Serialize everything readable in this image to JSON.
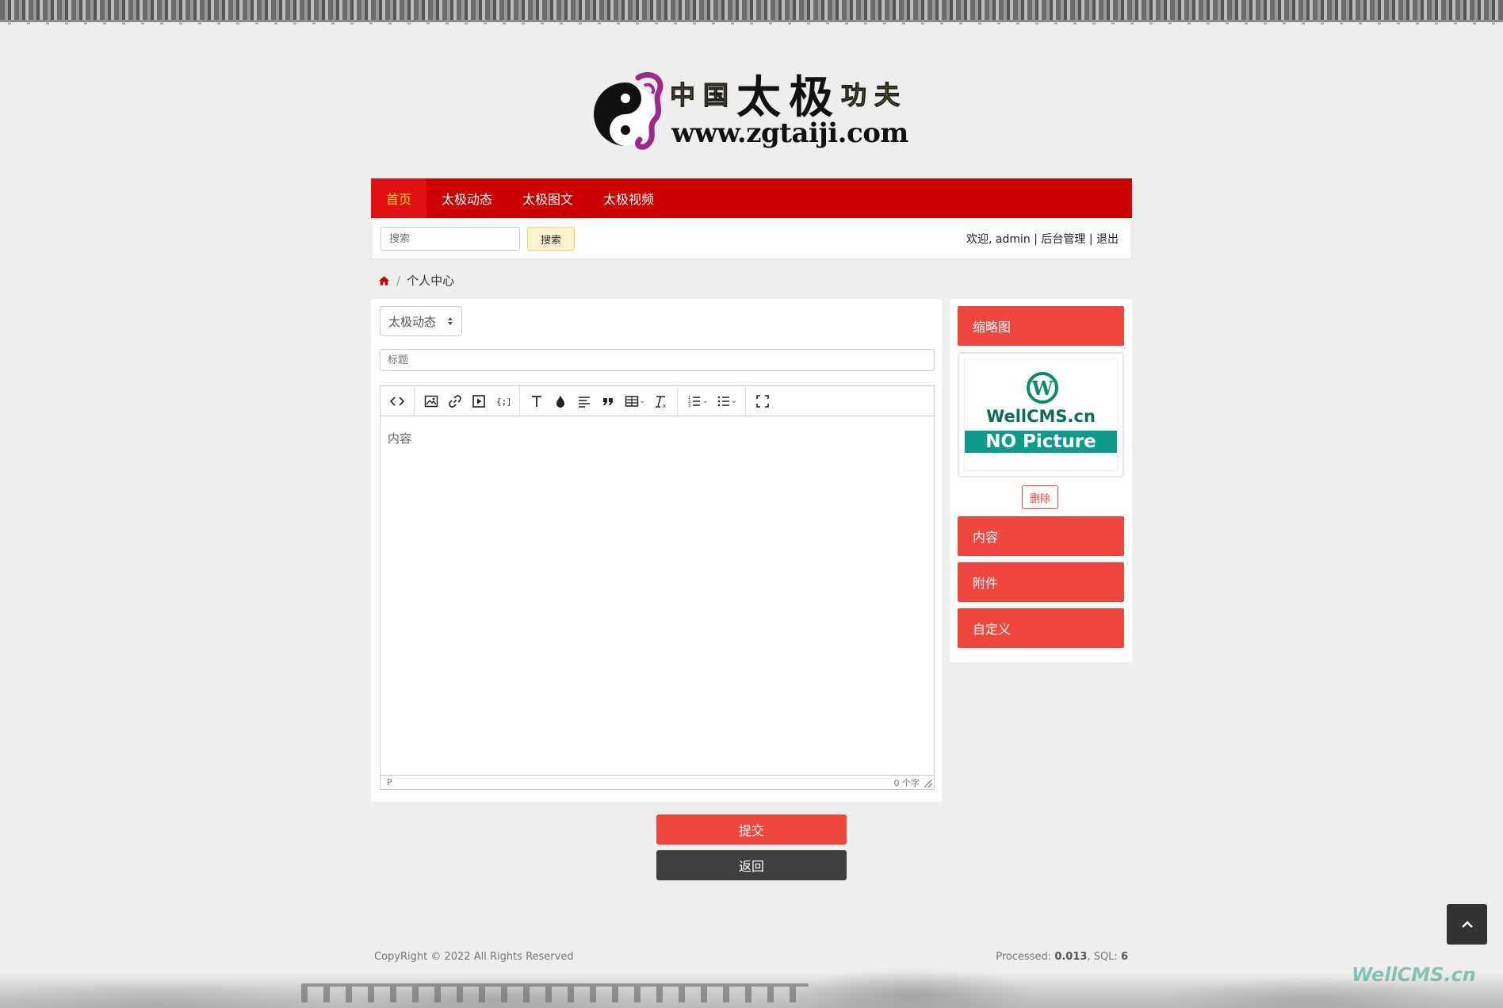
{
  "logo": {
    "chars": [
      "中",
      "国",
      "太",
      "极",
      "功",
      "夫"
    ],
    "url": "www.zgtaiji.com"
  },
  "nav": {
    "items": [
      {
        "label": "首页",
        "active": true
      },
      {
        "label": "太极动态",
        "active": false
      },
      {
        "label": "太极图文",
        "active": false
      },
      {
        "label": "太极视频",
        "active": false
      }
    ]
  },
  "search": {
    "placeholder": "搜索",
    "button_label": "搜索"
  },
  "userbar": {
    "welcome": "欢迎, admin",
    "admin_link": "后台管理",
    "logout_link": "退出",
    "separator": "|"
  },
  "breadcrumb": {
    "home_icon": "home-icon",
    "separator": "/",
    "current": "个人中心"
  },
  "form": {
    "category_selected": "太极动态",
    "title_placeholder": "标题",
    "content_placeholder": "内容",
    "status_path": "P",
    "word_count": "0 个字"
  },
  "side": {
    "thumbnail_label": "缩略图",
    "thumb_brand": "WellCMS.cn",
    "thumb_ribbon": "NO Picture",
    "delete_label": "删除",
    "content_label": "内容",
    "attachment_label": "附件",
    "custom_label": "自定义"
  },
  "actions": {
    "submit_label": "提交",
    "back_label": "返回"
  },
  "footer": {
    "copyright": "CopyRight © 2022 All Rights Reserved",
    "processed_label": "Processed:",
    "processed_value": "0.013",
    "sql_label": ", SQL:",
    "sql_value": "6",
    "watermark": "WellCMS.cn"
  },
  "colors": {
    "nav_red": "#cc0000",
    "accent_red": "#ef463e",
    "dark_button": "#3f3f3f",
    "active_nav_text": "#ffd700"
  }
}
